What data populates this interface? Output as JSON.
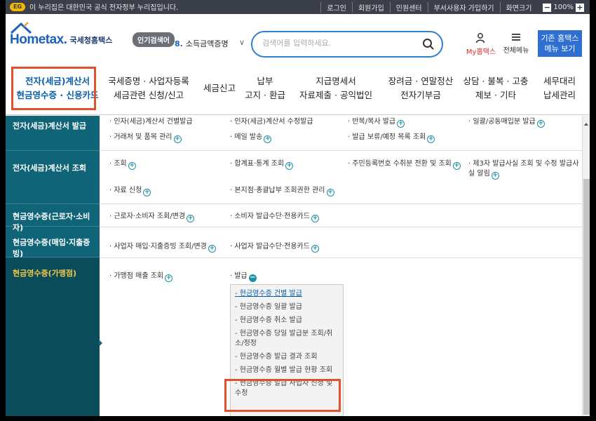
{
  "topbar": {
    "gov_notice": "이 누리집은 대한민국 공식 전자정부 누리집입니다.",
    "links": [
      "로그인",
      "회원가입",
      "민원센터",
      "부서사용자 가입하기",
      "화면크기"
    ],
    "zoom": "100%"
  },
  "header": {
    "logo_main": "Hometax.",
    "logo_sub": "국세청홈택스",
    "popular_label": "인기검색어",
    "popular_rank": "8.",
    "popular_term": "소득금액증명",
    "search_placeholder": "검색어를 입력하세요.",
    "my_hometax": "My홈택스",
    "all_menu": "전체메뉴",
    "classic_line1": "기존 홈택스",
    "classic_line2": "메뉴 보기"
  },
  "gnb": [
    {
      "l1": "전자(세금)계산서",
      "l2": "현금영수증 · 신용카드"
    },
    {
      "l1": "국세증명 · 사업자등록",
      "l2": "세금관련 신청/신고"
    },
    {
      "l1": "세금신고",
      "l2": ""
    },
    {
      "l1": "납부",
      "l2": "고지 · 환급"
    },
    {
      "l1": "지급명세서",
      "l2": "자료제출 · 공익법인"
    },
    {
      "l1": "장려금 · 연말정산",
      "l2": "전자기부금"
    },
    {
      "l1": "상담 · 불복 · 고충",
      "l2": "제보 · 기타"
    },
    {
      "l1": "세무대리",
      "l2": "납세관리"
    }
  ],
  "sidebar": [
    "전자(세금)계산서 발급",
    "전자(세금)계산서 조회",
    "현금영수증(근로자·소비자)",
    "현금영수증(매입·지출증빙)",
    "현금영수증(가맹점)"
  ],
  "content": {
    "r1": [
      "· 인자(세금)계산서 건별발급",
      "· 인자(세금)계산서 수정발급",
      "· 반복/복사 발급",
      "· 일괄/공동매입분 발급"
    ],
    "r1b": [
      "· 거래처 및 품목 관리",
      "· 메일 발송",
      "· 발급 보류/예정 목록 조회"
    ],
    "r2": [
      "· 조회",
      "· 합계표·통계 조회",
      "· 주민등록번호 수취분 전환 및 조회",
      "· 제3자 발급사실 조회 및 수정 발급사실 알림"
    ],
    "r2b": [
      "· 자료 신청",
      "· 본지점·총괄납부 조회권한 관리"
    ],
    "r3": [
      "· 근로자·소비자 조회/변경",
      "· 소비자 발급수단·전용카드"
    ],
    "r4": [
      "· 사업자 매입·지출증빙 조회/변경",
      "· 사업자 발급수단·전용카드"
    ],
    "r5": [
      "· 가맹점 매출 조회",
      "· 발급"
    ]
  },
  "submenu": [
    "- 현금영수증 건별 발급",
    "- 현금영수증 일괄 발급",
    "- 현금영수증 취소 발급",
    "- 현금영수증 당일 발급분 조회/취소/정정",
    "- 현금영수증 발급 결과 조회",
    "- 현금영수증 월별 발급 현황 조회",
    "- 현금영수증 발급 사업자 신청 및 수정"
  ],
  "colors": {
    "sidebar": "#0f6577",
    "sidebar_active_text": "#f6c84a",
    "highlight_box": "#e2512b",
    "accent_blue": "#2f6fd1"
  }
}
